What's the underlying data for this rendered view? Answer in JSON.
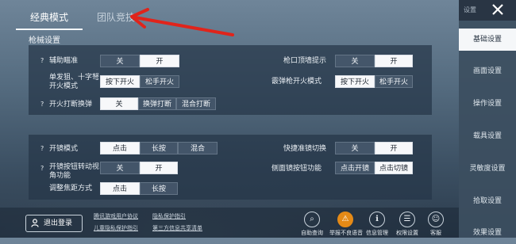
{
  "tabs": [
    "经典模式",
    "团队竞技"
  ],
  "sidebar": {
    "title": "设置",
    "items": [
      "基础设置",
      "画面设置",
      "操作设置",
      "载具设置",
      "灵敏度设置",
      "拾取设置",
      "效果设置"
    ]
  },
  "section": {
    "title": "枪械设置"
  },
  "rows": {
    "aim_assist": {
      "label": "辅助瞄准",
      "options": [
        "关",
        "开"
      ],
      "selected": "开"
    },
    "muzzle_hint": {
      "label": "枪口顶墙提示",
      "options": [
        "关",
        "开"
      ],
      "selected": "开"
    },
    "single_fire": {
      "label": "单发狙、十字弩开火模式",
      "options": [
        "按下开火",
        "松手开火"
      ],
      "selected": "按下开火"
    },
    "shotgun_fire": {
      "label": "霰弹枪开火模式",
      "options": [
        "按下开火",
        "松手开火"
      ],
      "selected": "按下开火"
    },
    "fire_interrupt": {
      "label": "开火打断换弹",
      "options": [
        "关",
        "换弹打断",
        "混合打断"
      ],
      "selected": "关"
    },
    "scope_mode": {
      "label": "开镜模式",
      "options": [
        "点击",
        "长按",
        "混合"
      ],
      "selected": "点击"
    },
    "quick_scope": {
      "label": "快捷准镜切换",
      "options": [
        "关",
        "开"
      ],
      "selected": "开"
    },
    "scope_view": {
      "label": "开镜按钮转动视角功能",
      "options": [
        "关",
        "开"
      ],
      "selected": "开"
    },
    "side_scope": {
      "label": "侧面镜按钮功能",
      "options": [
        "点击开镜",
        "点击切镜"
      ],
      "selected": "点击切镜"
    },
    "focus_mode": {
      "label": "调整焦距方式",
      "options": [
        "点击",
        "长按"
      ],
      "selected": "点击"
    }
  },
  "bottom": {
    "logout": "退出登录",
    "links": [
      "腾讯游戏用户协议",
      "隐私保护指引",
      "儿童隐私保护指引",
      "第三方信息共享清单"
    ],
    "icons": [
      {
        "label": "自助查询",
        "icon": "magnifier-icon"
      },
      {
        "label": "举报不良语音",
        "icon": "warning-icon"
      },
      {
        "label": "信息管理",
        "icon": "info-icon"
      },
      {
        "label": "权限设置",
        "icon": "permission-icon"
      },
      {
        "label": "客服",
        "icon": "support-icon"
      }
    ]
  }
}
